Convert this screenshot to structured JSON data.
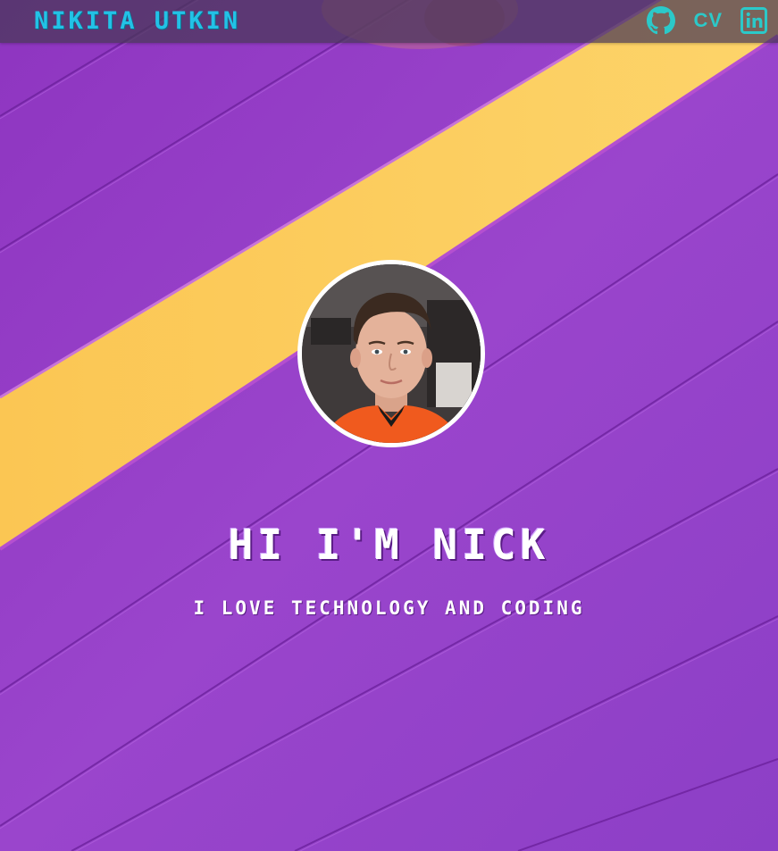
{
  "header": {
    "brand": "Nikita Utkin",
    "links": [
      {
        "label": "GitHub",
        "icon": "github-icon"
      },
      {
        "label": "CV",
        "icon": "cv-text"
      },
      {
        "label": "LinkedIn",
        "icon": "linkedin-icon"
      }
    ],
    "cv_label": "CV"
  },
  "hero": {
    "title": "Hi I'm Nick",
    "subtitle": "I love technology and coding",
    "avatar": "profile-photo"
  },
  "colors": {
    "accent": "#22c2e6",
    "icon": "#2bc9c9",
    "background_purple": "#8f3fc4",
    "stripe_yellow": "#fcc94f",
    "header_bg": "#463755"
  }
}
